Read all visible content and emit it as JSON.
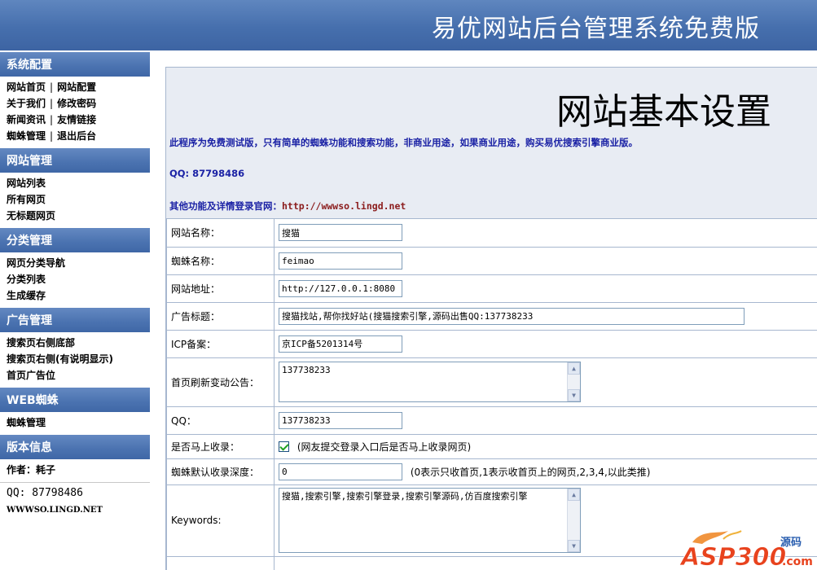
{
  "header": {
    "title": "易优网站后台管理系统免费版"
  },
  "sidebar": {
    "sections": [
      {
        "title": "系统配置",
        "rows": [
          [
            "网站首页",
            "网站配置"
          ],
          [
            "关于我们",
            "修改密码"
          ],
          [
            "新闻资讯",
            "友情链接"
          ],
          [
            "蜘蛛管理",
            "退出后台"
          ]
        ]
      },
      {
        "title": "网站管理",
        "rows": [
          [
            "网站列表"
          ],
          [
            "所有网页"
          ],
          [
            "无标题网页"
          ]
        ]
      },
      {
        "title": "分类管理",
        "rows": [
          [
            "网页分类导航"
          ],
          [
            "分类列表"
          ],
          [
            "生成缓存"
          ]
        ]
      },
      {
        "title": "广告管理",
        "rows": [
          [
            "搜索页右侧底部"
          ],
          [
            "搜索页右侧(有说明显示)"
          ],
          [
            "首页广告位"
          ]
        ]
      },
      {
        "title": "WEB蜘蛛",
        "rows": [
          [
            "蜘蛛管理"
          ]
        ]
      },
      {
        "title": "版本信息",
        "rows": [
          [
            "作者：耗子"
          ]
        ]
      }
    ],
    "separator": "|",
    "qq": "QQ: 87798486",
    "url": "WWWSO.LINGD.NET"
  },
  "main": {
    "title": "网站基本设置",
    "notice": "此程序为免费测试版，只有简单的蜘蛛功能和搜索功能，非商业用途，如果商业用途，购买易优搜索引擎商业版。",
    "qq": "QQ: 87798486",
    "site_label": "其他功能及详情登录官网：",
    "site_url": "http://wwwso.lingd.net"
  },
  "form": {
    "site_name": {
      "label": "网站名称：",
      "value": "搜猫"
    },
    "spider_name": {
      "label": "蜘蛛名称：",
      "value": "feimao"
    },
    "site_url": {
      "label": "网站地址：",
      "value": "http://127.0.0.1:8080"
    },
    "ad_title": {
      "label": "广告标题：",
      "value": "搜猫找站,帮你找好站(搜猫搜索引擎,源码出售QQ:137738233"
    },
    "icp": {
      "label": "ICP备案：",
      "value": "京ICP备5201314号"
    },
    "home_notice": {
      "label": "首页刷新变动公告：",
      "value": "137738233"
    },
    "qq": {
      "label": "QQ：",
      "value": "137738233"
    },
    "auto_index": {
      "label": "是否马上收录：",
      "checked": true,
      "hint": "(网友提交登录入口后是否马上收录网页)"
    },
    "depth": {
      "label": "蜘蛛默认收录深度：",
      "value": "0",
      "hint": "(0表示只收首页,1表示收首页上的网页,2,3,4,以此类推)"
    },
    "keywords": {
      "label": "Keywords:",
      "value": "搜猫,搜索引擎,搜索引擎登录,搜索引擎源码,仿百度搜索引擎"
    }
  },
  "watermark": {
    "text_main": "ASP300",
    "text_sub": "源码",
    "domain": ".com",
    "color_main": "#e8431e",
    "color_sub": "#2b5fb0"
  }
}
